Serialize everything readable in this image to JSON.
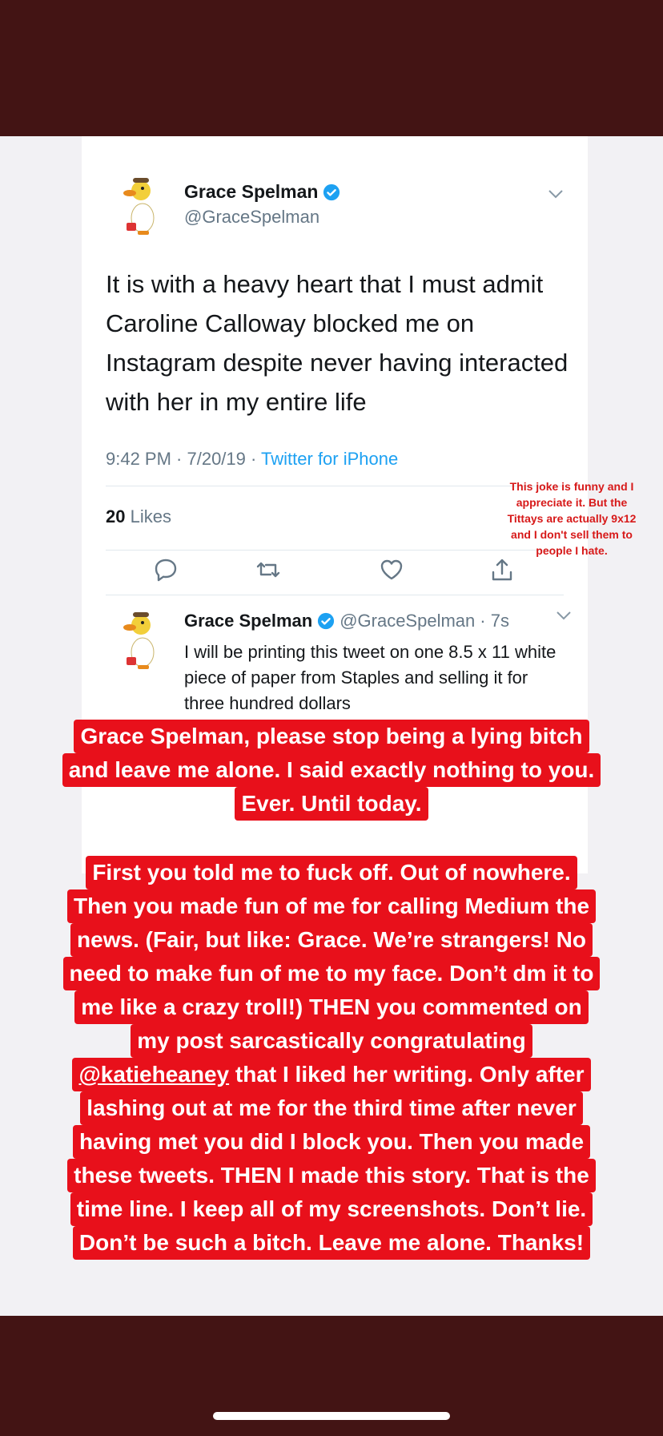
{
  "tweet": {
    "author_name": "Grace Spelman",
    "author_handle": "@GraceSpelman",
    "text": "It is with a heavy heart that I must admit Caroline Calloway blocked me on Instagram despite never having interacted with her in my entire life",
    "meta_time": "9:42 PM · 7/20/19 · ",
    "meta_source": "Twitter for iPhone",
    "likes_count": "20",
    "likes_label": " Likes"
  },
  "reply": {
    "author_name": "Grace Spelman",
    "author_handle": "@GraceSpelman",
    "age": "· 7s",
    "text": "I will be printing this tweet on one 8.5 x 11 white piece of paper from Staples and selling it for three hundred dollars"
  },
  "side_note": {
    "lines": [
      "This joke is funny and I",
      "appreciate it. But the",
      "Tittays are actually 9x12",
      "and I don't sell them to",
      "people I hate."
    ]
  },
  "callout_1": {
    "lines": [
      "Grace Spelman, please stop being a lying bitch",
      "and leave me alone. I said exactly nothing to you.",
      "Ever. Until today."
    ]
  },
  "callout_2": {
    "line_1": "First you told me to fuck off. Out of nowhere.",
    "line_2": "Then you made fun of me for calling Medium the",
    "line_3": "news. (Fair, but like: Grace. We’re strangers! No",
    "line_4": "need to make fun of me to my face. Don’t dm it to",
    "line_5": "me like a crazy troll!) THEN you commented on",
    "line_6": "my post sarcastically congratulating",
    "line_7_mention": "@katieheaney",
    "line_7_rest": " that I liked her writing. Only after",
    "line_8": "lashing out at me for the third time after never",
    "line_9": "having met you did I block you. Then you made",
    "line_10": "these tweets. THEN I made this story.  That is the",
    "line_11": "time line. I keep all of my screenshots. Don’t lie.",
    "line_12": "Don’t be such a bitch. Leave me alone. Thanks!"
  },
  "icons": [
    "duck-avatar-icon",
    "verified-badge-icon",
    "chevron-down-icon",
    "reply-icon",
    "retweet-icon",
    "like-icon",
    "share-icon"
  ],
  "colors": {
    "story_bar": "#431414",
    "callout_red": "#e8101b",
    "note_red": "#d71919",
    "twitter_blue": "#1da1f2"
  }
}
